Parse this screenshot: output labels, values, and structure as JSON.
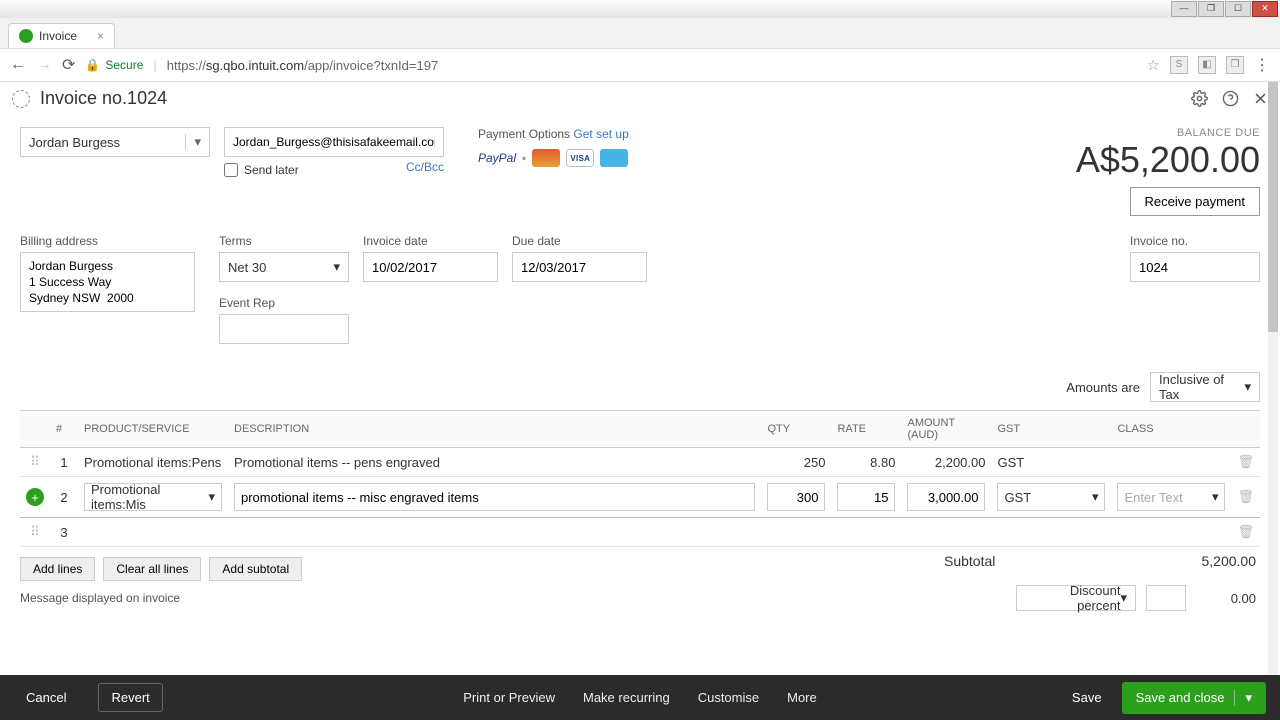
{
  "window": {
    "tab_title": "Invoice",
    "url_prefix": "https://",
    "url_host": "sg.qbo.intuit.com",
    "url_path": "/app/invoice?txnId=197",
    "secure_label": "Secure"
  },
  "header": {
    "title": "Invoice no.1024"
  },
  "customer": {
    "name": "Jordan Burgess",
    "email": "Jordan_Burgess@thisisafakeemail.com",
    "send_later_label": "Send later",
    "ccbcc_label": "Cc/Bcc"
  },
  "payment": {
    "label": "Payment Options",
    "setup_link": "Get set up",
    "paypal": "PayPal",
    "visa": "VISA"
  },
  "balance": {
    "label": "BALANCE DUE",
    "amount": "A$5,200.00",
    "receive_btn": "Receive payment"
  },
  "billing": {
    "label": "Billing address",
    "text": "Jordan Burgess\n1 Success Way\nSydney NSW  2000"
  },
  "terms": {
    "label": "Terms",
    "value": "Net 30"
  },
  "invoice_date": {
    "label": "Invoice date",
    "value": "10/02/2017"
  },
  "due_date": {
    "label": "Due date",
    "value": "12/03/2017"
  },
  "event_rep": {
    "label": "Event Rep",
    "value": ""
  },
  "invoice_no": {
    "label": "Invoice no.",
    "value": "1024"
  },
  "amounts_are": {
    "label": "Amounts are",
    "value": "Inclusive of Tax"
  },
  "columns": {
    "num": "#",
    "product": "PRODUCT/SERVICE",
    "description": "DESCRIPTION",
    "qty": "QTY",
    "rate": "RATE",
    "amount": "AMOUNT (AUD)",
    "gst": "GST",
    "class": "CLASS"
  },
  "lines": [
    {
      "n": "1",
      "product": "Promotional items:Pens",
      "desc": "Promotional items -- pens engraved",
      "qty": "250",
      "rate": "8.80",
      "amount": "2,200.00",
      "gst": "GST",
      "class": ""
    },
    {
      "n": "2",
      "product": "Promotional items:Mis",
      "desc": "promotional items -- misc engraved items",
      "qty": "300",
      "rate": "15",
      "amount": "3,000.00",
      "gst": "GST",
      "class": ""
    },
    {
      "n": "3",
      "product": "",
      "desc": "",
      "qty": "",
      "rate": "",
      "amount": "",
      "gst": "",
      "class": ""
    }
  ],
  "class_placeholder": "Enter Text",
  "table_buttons": {
    "add_lines": "Add lines",
    "clear_all": "Clear all lines",
    "add_subtotal": "Add subtotal"
  },
  "subtotal": {
    "label": "Subtotal",
    "value": "5,200.00"
  },
  "discount": {
    "label": "Discount percent",
    "value": "0.00"
  },
  "message_label": "Message displayed on invoice",
  "footer": {
    "cancel": "Cancel",
    "revert": "Revert",
    "print": "Print or Preview",
    "recurring": "Make recurring",
    "customise": "Customise",
    "more": "More",
    "save": "Save",
    "save_close": "Save and close"
  }
}
